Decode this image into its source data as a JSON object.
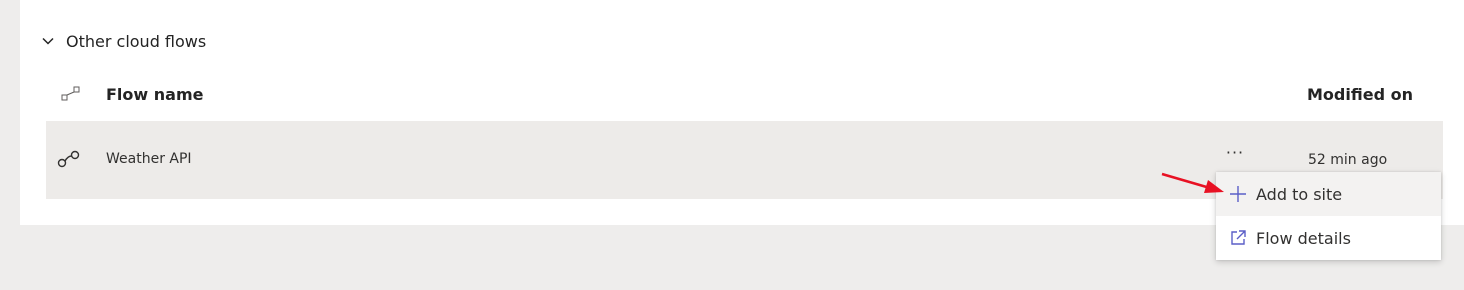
{
  "section": {
    "title": "Other cloud flows",
    "expanded": true
  },
  "table": {
    "headers": {
      "name": "Flow name",
      "modified": "Modified on"
    },
    "rows": [
      {
        "name": "Weather API",
        "more": "···",
        "modified": "52 min ago"
      }
    ]
  },
  "context_menu": {
    "items": [
      {
        "label": "Add to site",
        "icon": "plus-icon"
      },
      {
        "label": "Flow details",
        "icon": "open-external-icon"
      }
    ]
  },
  "colors": {
    "accent": "#5b5fc7",
    "annotation_arrow": "#e81123",
    "row_selected_bg": "#edebe9",
    "page_bg": "#eeedec"
  }
}
